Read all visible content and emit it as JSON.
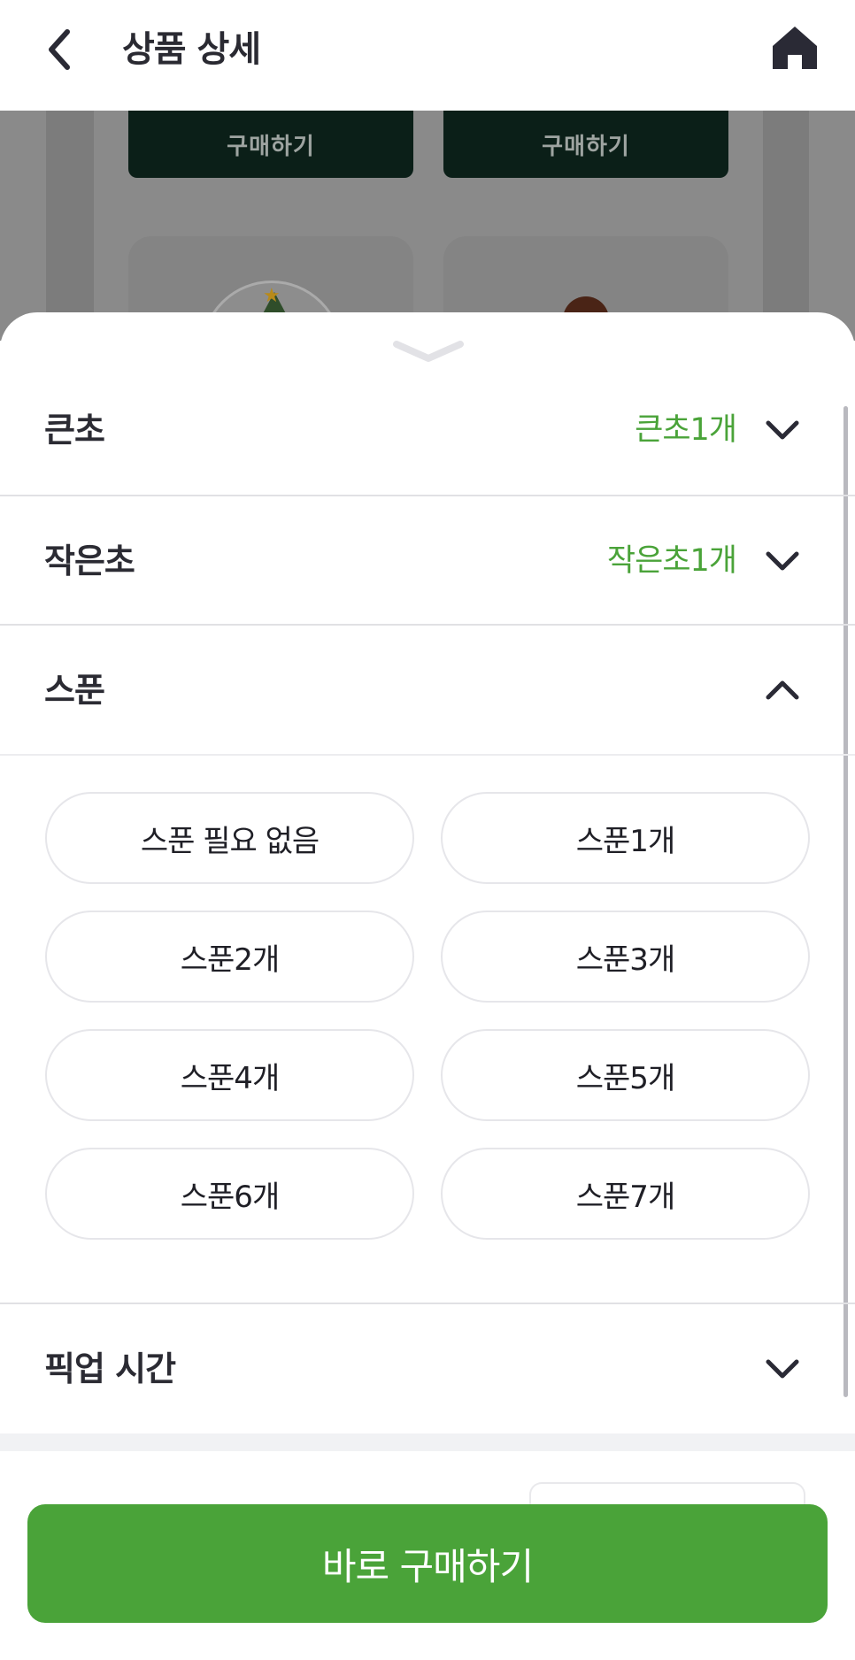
{
  "header": {
    "title": "상품 상세",
    "back_icon": "chevron-left-icon",
    "home_icon": "home-icon"
  },
  "background": {
    "buy_labels": [
      "구매하기",
      "구매하기"
    ]
  },
  "sheet": {
    "handle_icon": "chevron-down-icon",
    "options": [
      {
        "label": "큰초",
        "value": "큰초1개",
        "expanded": false
      },
      {
        "label": "작은초",
        "value": "작은초1개",
        "expanded": false
      },
      {
        "label": "스푼",
        "value": "",
        "expanded": true
      },
      {
        "label": "픽업 시간",
        "value": "",
        "expanded": false
      }
    ],
    "spoon_choices": [
      "스푼 필요 없음",
      "스푼1개",
      "스푼2개",
      "스푼3개",
      "스푼4개",
      "스푼5개",
      "스푼6개",
      "스푼7개"
    ]
  },
  "buy_button": {
    "label": "바로 구매하기"
  },
  "colors": {
    "accent": "#4aa339",
    "text": "#2b2b33",
    "divider": "#e1e1e4"
  }
}
